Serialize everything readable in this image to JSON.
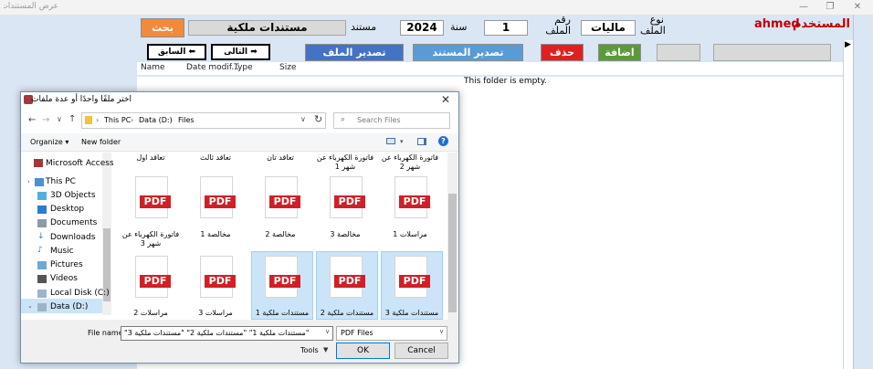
{
  "window": {
    "title": "عرض المستندات",
    "minimize": "—",
    "maximize": "❐",
    "close": "✕"
  },
  "header": {
    "user_label": "اسم المستخدم",
    "user_name": "ahmed",
    "type_label": "نوع الملف",
    "type_value": "ماليات",
    "number_label": "رقم الملف",
    "number_value": "1",
    "year_label": "سنة",
    "year_value": "2024",
    "doc_label": "مستند",
    "doc_value": "مستندات ملكية",
    "search_button": "بحث"
  },
  "actions": {
    "add": "اضافة",
    "delete": "حذف",
    "export_doc": "تصدير المستند",
    "export_file": "تصدير الملف",
    "next": "التالى ➡",
    "prev": "السابق ⬅"
  },
  "file_list": {
    "columns": [
      "Name",
      "Date modif...",
      "Type",
      "Size"
    ],
    "empty_text": "This folder is empty."
  },
  "dialog": {
    "title": "اختر ملفًا واحدًا أو عدة ملفات",
    "close": "✕",
    "breadcrumb": [
      "This PC",
      "Data (D:)",
      "Files"
    ],
    "search_placeholder": "Search Files",
    "organize": "Organize ▾",
    "new_folder": "New folder",
    "nav_items": [
      "Microsoft Access",
      "This PC",
      "3D Objects",
      "Desktop",
      "Documents",
      "Downloads",
      "Music",
      "Pictures",
      "Videos",
      "Local Disk (C:)",
      "Data (D:)"
    ],
    "row0_labels": [
      "تعاقد اول",
      "تعاقد ثالث",
      "تعاقد تان",
      "فاتورة الكهرباء عن شهر 1",
      "فاتورة الكهرباء عن شهر 2"
    ],
    "row1_labels": [
      "فاتورة الكهرباء عن شهر 3",
      "مخالصة 1",
      "مخالصة 2",
      "مخالصة 3",
      "مراسلات 1"
    ],
    "row2_labels": [
      "مراسلات 2",
      "مراسلات 3",
      "مستندات ملكية 1",
      "مستندات ملكية 2",
      "مستندات ملكية 3"
    ],
    "pdf_label": "PDF",
    "file_name_label": "File name:",
    "file_name_value": "\"مستندات ملكية 1\" \"مستندات ملكية 2\" \"مستندات ملكية 3\"",
    "filter": "PDF Files",
    "tools": "Tools",
    "ok": "OK",
    "cancel": "Cancel"
  },
  "colors": {
    "accent_search": "#f28a3c",
    "add_green": "#5b9a3c",
    "delete_red": "#e02020",
    "export_doc_blue": "#5b9bd5",
    "export_file_blue": "#4472c4",
    "user_red": "#c00000",
    "pdf_red": "#d02027",
    "selection": "#cce4f7"
  }
}
